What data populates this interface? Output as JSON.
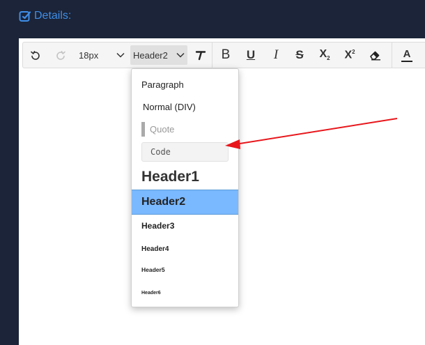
{
  "header": {
    "title": "Details:",
    "icon": "edit-square-icon",
    "color": "#3f8ee8"
  },
  "toolbar": {
    "undo_icon": "undo-icon",
    "redo_icon": "redo-icon",
    "font_size": "18px",
    "block_format": "Header2",
    "buttons": [
      {
        "icon": "clear-format-icon"
      },
      {
        "icon": "bold-icon",
        "label": "B"
      },
      {
        "icon": "underline-icon",
        "label": "U"
      },
      {
        "icon": "italic-icon",
        "label": "I"
      },
      {
        "icon": "strikethrough-icon",
        "label": "S"
      },
      {
        "icon": "subscript-icon",
        "label": "X",
        "sub": "2"
      },
      {
        "icon": "superscript-icon",
        "label": "X",
        "sup": "2"
      },
      {
        "icon": "eraser-icon"
      },
      {
        "icon": "font-color-icon",
        "label": "A"
      }
    ]
  },
  "dropdown": {
    "items": [
      {
        "label": "Paragraph"
      },
      {
        "label": "Normal (DIV)"
      },
      {
        "label": "Quote"
      },
      {
        "label": "Code"
      },
      {
        "label": "Header1"
      },
      {
        "label": "Header2",
        "selected": true
      },
      {
        "label": "Header3"
      },
      {
        "label": "Header4"
      },
      {
        "label": "Header5"
      },
      {
        "label": "Header6"
      }
    ],
    "selected_color": "#7ab8ff"
  },
  "annotation": {
    "arrow_color": "#e8161b"
  }
}
